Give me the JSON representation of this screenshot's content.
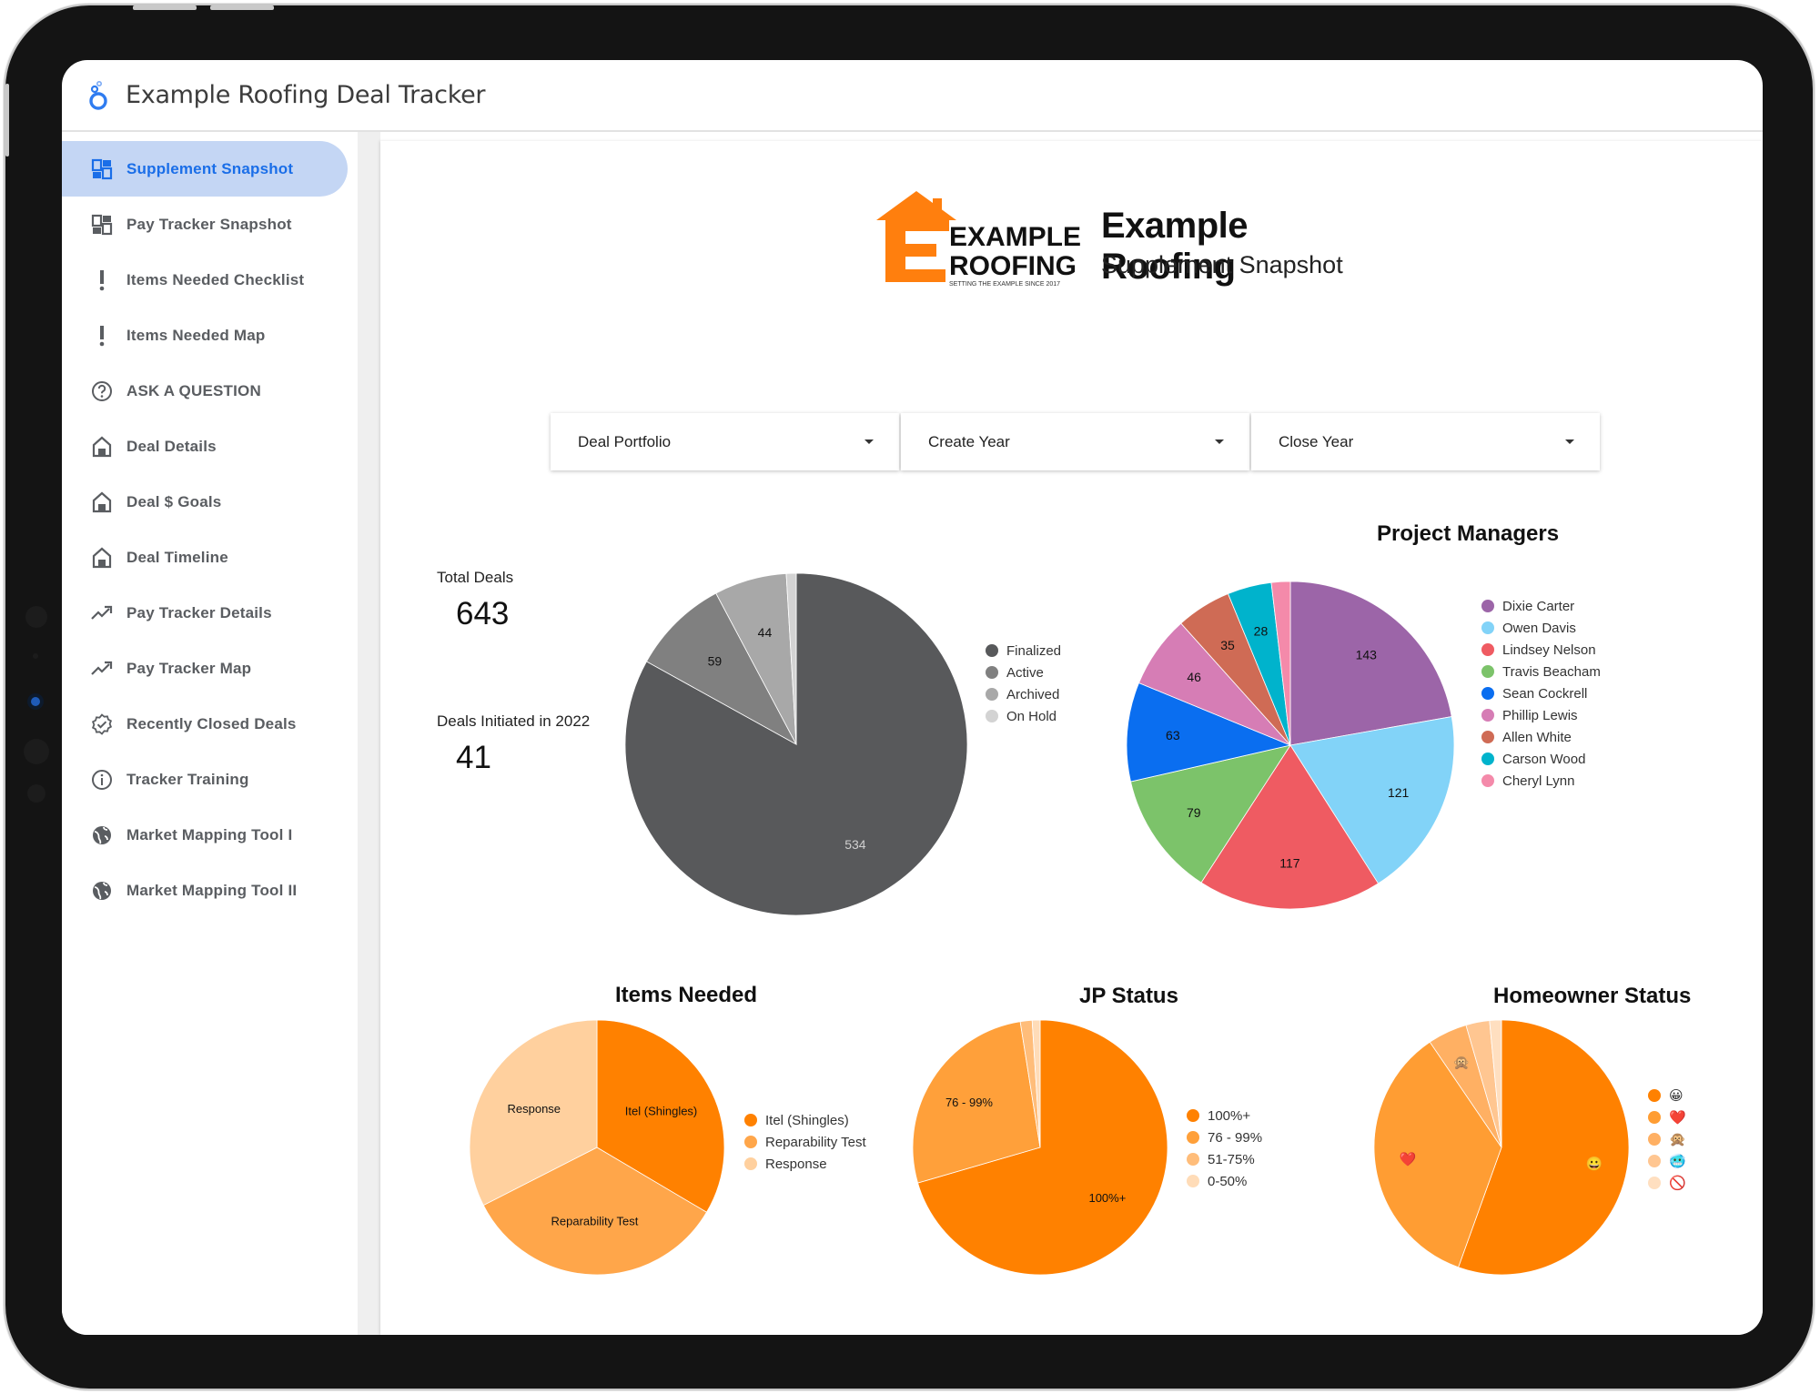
{
  "app": {
    "title": "Example Roofing Deal Tracker",
    "logo_icon": "looker-studio-logo-icon"
  },
  "sidebar": {
    "items": [
      {
        "label": "Supplement Snapshot",
        "icon": "dashboard-icon",
        "active": true
      },
      {
        "label": "Pay Tracker Snapshot",
        "icon": "dashboard-icon",
        "active": false
      },
      {
        "label": "Items Needed Checklist",
        "icon": "exclamation-icon",
        "active": false
      },
      {
        "label": "Items Needed Map",
        "icon": "exclamation-icon",
        "active": false
      },
      {
        "label": "ASK A QUESTION",
        "icon": "help-circle-icon",
        "active": false
      },
      {
        "label": "Deal Details",
        "icon": "home-icon",
        "active": false
      },
      {
        "label": "Deal $ Goals",
        "icon": "home-icon",
        "active": false
      },
      {
        "label": "Deal Timeline",
        "icon": "home-icon",
        "active": false
      },
      {
        "label": "Pay Tracker Details",
        "icon": "trending-up-icon",
        "active": false
      },
      {
        "label": "Pay Tracker Map",
        "icon": "trending-up-icon",
        "active": false
      },
      {
        "label": "Recently Closed Deals",
        "icon": "verified-badge-icon",
        "active": false
      },
      {
        "label": "Tracker Training",
        "icon": "info-icon",
        "active": false
      },
      {
        "label": "Market Mapping Tool I",
        "icon": "globe-icon",
        "active": false
      },
      {
        "label": "Market Mapping Tool II",
        "icon": "globe-icon",
        "active": false
      }
    ]
  },
  "brand": {
    "logo_line1": "EXAMPLE",
    "logo_line2": "ROOFING",
    "logo_tagline": "SETTING THE EXAMPLE SINCE 2017",
    "company": "Example Roofing",
    "page_subtitle": "Supplement Snapshot",
    "accent": "#ff7f0e"
  },
  "filters": [
    {
      "label": "Deal Portfolio"
    },
    {
      "label": "Create Year"
    },
    {
      "label": "Close Year"
    }
  ],
  "kpis": {
    "total_deals_label": "Total Deals",
    "total_deals_value": "643",
    "initiated_label": "Deals Initiated in 2022",
    "initiated_value": "41"
  },
  "chart_data": [
    {
      "id": "deal-status",
      "type": "pie",
      "title": "",
      "categories": [
        "Finalized",
        "Active",
        "Archived",
        "On Hold"
      ],
      "values": [
        534,
        59,
        44,
        6
      ],
      "data_labels": [
        "534",
        "59",
        "44",
        ""
      ],
      "colors": [
        "#58595b",
        "#808080",
        "#a8a8a8",
        "#d3d3d3"
      ],
      "legend": "right"
    },
    {
      "id": "project-managers",
      "type": "pie",
      "title": "Project Managers",
      "categories": [
        "Dixie Carter",
        "Owen Davis",
        "Lindsey Nelson",
        "Travis Beacham",
        "Sean Cockrell",
        "Phillip Lewis",
        "Allen White",
        "Carson Wood",
        "Cheryl Lynn"
      ],
      "values": [
        143,
        121,
        117,
        79,
        63,
        46,
        35,
        28,
        12
      ],
      "data_labels": [
        "143",
        "121",
        "117",
        "79",
        "63",
        "46",
        "35",
        "28",
        ""
      ],
      "colors": [
        "#9c65a8",
        "#82d3f8",
        "#ef5b62",
        "#7cc36a",
        "#0a6ef0",
        "#d67db5",
        "#cf6b55",
        "#00b3cc",
        "#f48aaa"
      ],
      "legend": "right"
    },
    {
      "id": "items-needed",
      "type": "pie",
      "title": "Items Needed",
      "categories": [
        "Itel (Shingles)",
        "Reparability Test",
        "Response"
      ],
      "values": [
        33.5,
        34,
        32.5
      ],
      "data_labels": [
        "Itel (Shingles)",
        "Reparability Test",
        "Response"
      ],
      "colors": [
        "#ff8100",
        "#ffa64a",
        "#ffd09e"
      ],
      "legend": "right"
    },
    {
      "id": "jp-status",
      "type": "pie",
      "title": "JP Status",
      "categories": [
        "100%+",
        "76 - 99%",
        "51-75%",
        "0-50%"
      ],
      "values": [
        70.5,
        27,
        1.5,
        1
      ],
      "data_labels": [
        "100%+",
        "76 - 99%",
        "",
        ""
      ],
      "colors": [
        "#ff8100",
        "#ffa03a",
        "#ffbd7a",
        "#ffdcb8"
      ],
      "legend": "right"
    },
    {
      "id": "homeowner-status",
      "type": "pie",
      "title": "Homeowner Status",
      "categories": [
        "😀",
        "❤️",
        "🙊",
        "🥶",
        "🚫"
      ],
      "values": [
        55.5,
        35,
        5,
        3,
        1.5
      ],
      "data_labels": [
        "😀",
        "❤️",
        "🙊",
        "",
        ""
      ],
      "colors": [
        "#ff8100",
        "#ff9d33",
        "#ffb063",
        "#ffc691",
        "#ffdfc0"
      ],
      "legend": "right"
    }
  ]
}
